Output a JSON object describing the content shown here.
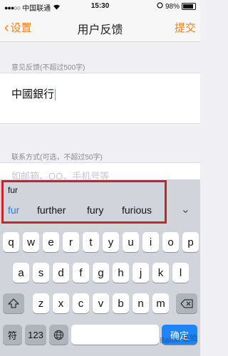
{
  "status": {
    "carrier": "中国联通",
    "time": "15:30",
    "battery": "98%",
    "battery_level": 0.98
  },
  "nav": {
    "back_label": "设置",
    "title": "用户反馈",
    "submit_label": "提交"
  },
  "feedback": {
    "label": "意见反馈(不超过500字)",
    "value": "中國銀行"
  },
  "contact": {
    "label": "联系方式(可选，不超过50字)",
    "placeholder": "如邮箱、QQ、手机号等"
  },
  "autocorrect": {
    "typed": "fur",
    "suggestions": [
      "fur",
      "further",
      "fury",
      "furious"
    ]
  },
  "keyboard": {
    "row1": [
      "q",
      "w",
      "e",
      "r",
      "t",
      "y",
      "u",
      "i",
      "o",
      "p"
    ],
    "row2": [
      "a",
      "s",
      "d",
      "f",
      "g",
      "h",
      "j",
      "k",
      "l"
    ],
    "row3": [
      "z",
      "x",
      "c",
      "v",
      "b",
      "n",
      "m"
    ],
    "symbol_key": "符",
    "numbers_key": "123",
    "confirm_key": "确定"
  },
  "watermark": "Baidu 经验"
}
